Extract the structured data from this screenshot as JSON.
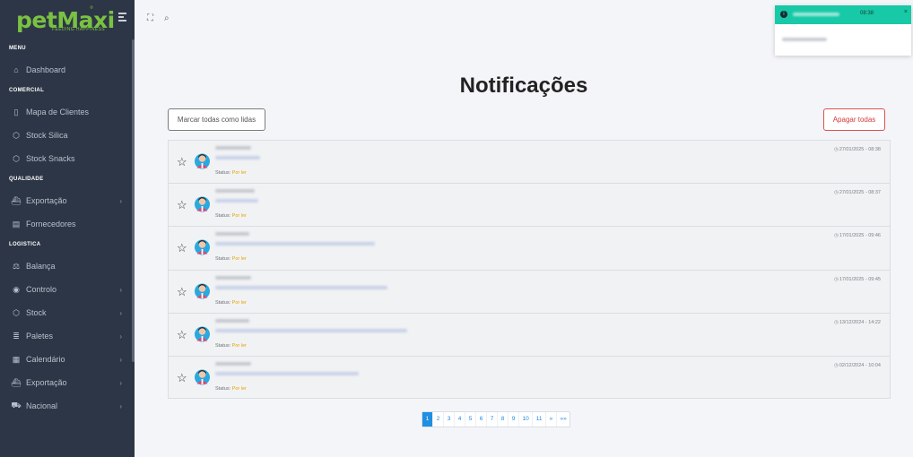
{
  "sidebar": {
    "logo": "petMaxi",
    "logo_mark": "°",
    "tagline": "FEEDING HAPPINESS",
    "sections": {
      "menu": "MENU",
      "comercial": "COMERCIAL",
      "qualidade": "QUALIDADE",
      "logistica": "LOGISTICA"
    },
    "items": {
      "dashboard": "Dashboard",
      "mapa": "Mapa de Clientes",
      "silica": "Stock Silica",
      "snacks": "Stock Snacks",
      "exportacao_q": "Exportação",
      "fornecedores": "Fornecedores",
      "balanca": "Balança",
      "controlo": "Controlo",
      "stock": "Stock",
      "paletes": "Paletes",
      "calendario": "Calendário",
      "exportacao_l": "Exportação",
      "nacional": "Nacional"
    }
  },
  "page": {
    "title": "Notificações",
    "mark_all_label": "Marcar todas como lidas",
    "delete_all_label": "Apagar todas"
  },
  "notifications": [
    {
      "status_label": "Status:",
      "status_value": "Por ler",
      "time": "27/01/2025 - 08:38"
    },
    {
      "status_label": "Status:",
      "status_value": "Por ler",
      "time": "27/01/2025 - 08:37"
    },
    {
      "status_label": "Status:",
      "status_value": "Por ler",
      "time": "17/01/2025 - 09:46"
    },
    {
      "status_label": "Status:",
      "status_value": "Por ler",
      "time": "17/01/2025 - 09:45"
    },
    {
      "status_label": "Status:",
      "status_value": "Por ler",
      "time": "13/12/2024 - 14:22"
    },
    {
      "status_label": "Status:",
      "status_value": "Por ler",
      "time": "02/12/2024 - 10:04"
    }
  ],
  "pagination": {
    "pages": [
      "1",
      "2",
      "3",
      "4",
      "5",
      "6",
      "7",
      "8",
      "9",
      "10",
      "11"
    ],
    "next": "»",
    "last": "»»",
    "active": "1"
  },
  "toast": {
    "time": "08:38",
    "close": "×"
  },
  "colors": {
    "sidebar_bg": "#2d3646",
    "brand_green": "#7ac143",
    "accent_blue": "#1e8fe1",
    "toast_teal": "#17c9a6",
    "status_unread": "#e6a400",
    "danger": "#d43a3a"
  }
}
